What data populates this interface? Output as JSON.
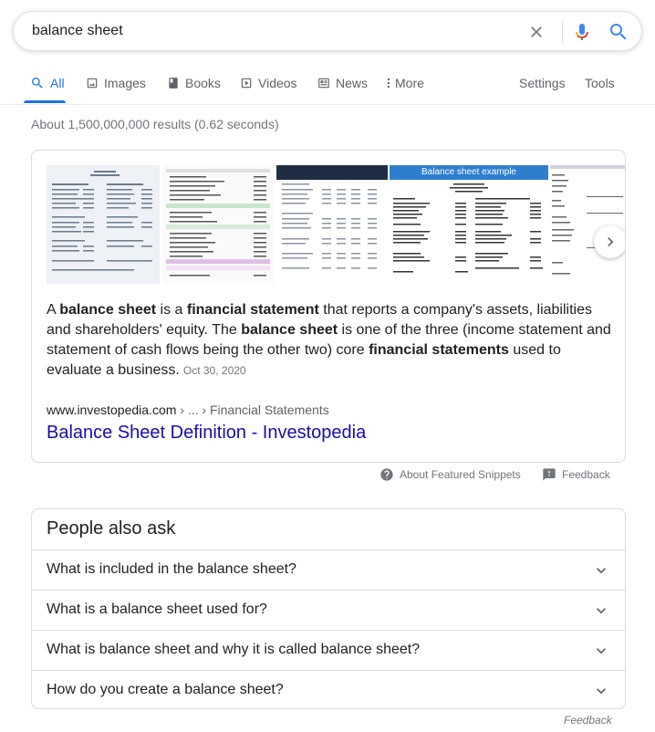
{
  "search": {
    "query": "balance sheet"
  },
  "tabs": [
    {
      "label": "All",
      "icon": "search-icon"
    },
    {
      "label": "Images",
      "icon": "image-icon"
    },
    {
      "label": "Books",
      "icon": "book-icon"
    },
    {
      "label": "Videos",
      "icon": "video-icon"
    },
    {
      "label": "News",
      "icon": "news-icon"
    },
    {
      "label": "More",
      "icon": "kebab-icon"
    }
  ],
  "tools": {
    "settings": "Settings",
    "tools": "Tools"
  },
  "result_stats": "About 1,500,000,000 results (0.62 seconds)",
  "featured": {
    "thumbnail_caption": "Balance sheet example",
    "snippet": {
      "p1": "A ",
      "b1": "balance sheet",
      "p2": " is a ",
      "b2": "financial statement",
      "p3": " that reports a company's assets, liabilities and shareholders' equity. The ",
      "b3": "balance sheet",
      "p4": " is one of the three (income statement and statement of cash flows being the other two) core ",
      "b4": "financial statements",
      "p5": " used to evaluate a business.",
      "date": "Oct 30, 2020"
    },
    "cite_domain": "www.investopedia.com",
    "cite_path": " › ... › Financial Statements",
    "link_title": "Balance Sheet Definition - Investopedia"
  },
  "snippet_meta": {
    "about": "About Featured Snippets",
    "feedback": "Feedback"
  },
  "people_also_ask": {
    "title": "People also ask",
    "questions": [
      "What is included in the balance sheet?",
      "What is a balance sheet used for?",
      "What is balance sheet and why it is called balance sheet?",
      "How do you create a balance sheet?"
    ]
  },
  "footer_feedback": "Feedback",
  "colors": {
    "accent": "#1a73e8",
    "link": "#1a0dab",
    "mic_red": "#ea4335",
    "text": "#202124",
    "muted": "#70757a"
  }
}
